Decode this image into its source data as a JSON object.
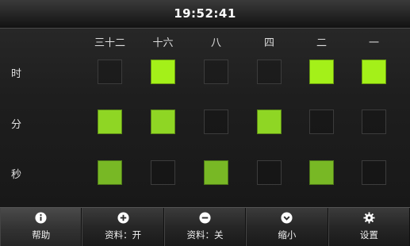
{
  "header": {
    "time": "19:52:41"
  },
  "grid": {
    "columns": [
      "三十二",
      "十六",
      "八",
      "四",
      "二",
      "一"
    ],
    "rows": [
      {
        "label": "时",
        "bits": [
          0,
          1,
          0,
          0,
          1,
          1
        ],
        "color": "#a4f019"
      },
      {
        "label": "分",
        "bits": [
          1,
          1,
          0,
          1,
          0,
          0
        ],
        "color": "#8fd624"
      },
      {
        "label": "秒",
        "bits": [
          1,
          0,
          1,
          0,
          1,
          0
        ],
        "color": "#78b825"
      }
    ]
  },
  "toolbar": {
    "items": [
      {
        "label": "帮助",
        "icon": "info-icon",
        "name": "help-button"
      },
      {
        "label": "资料：开",
        "icon": "plus-icon",
        "name": "info-on-button"
      },
      {
        "label": "资料：关",
        "icon": "minus-icon",
        "name": "info-off-button"
      },
      {
        "label": "缩小",
        "icon": "chevron-down-icon",
        "name": "minimize-button"
      },
      {
        "label": "设置",
        "icon": "gear-icon",
        "name": "settings-button"
      }
    ]
  }
}
